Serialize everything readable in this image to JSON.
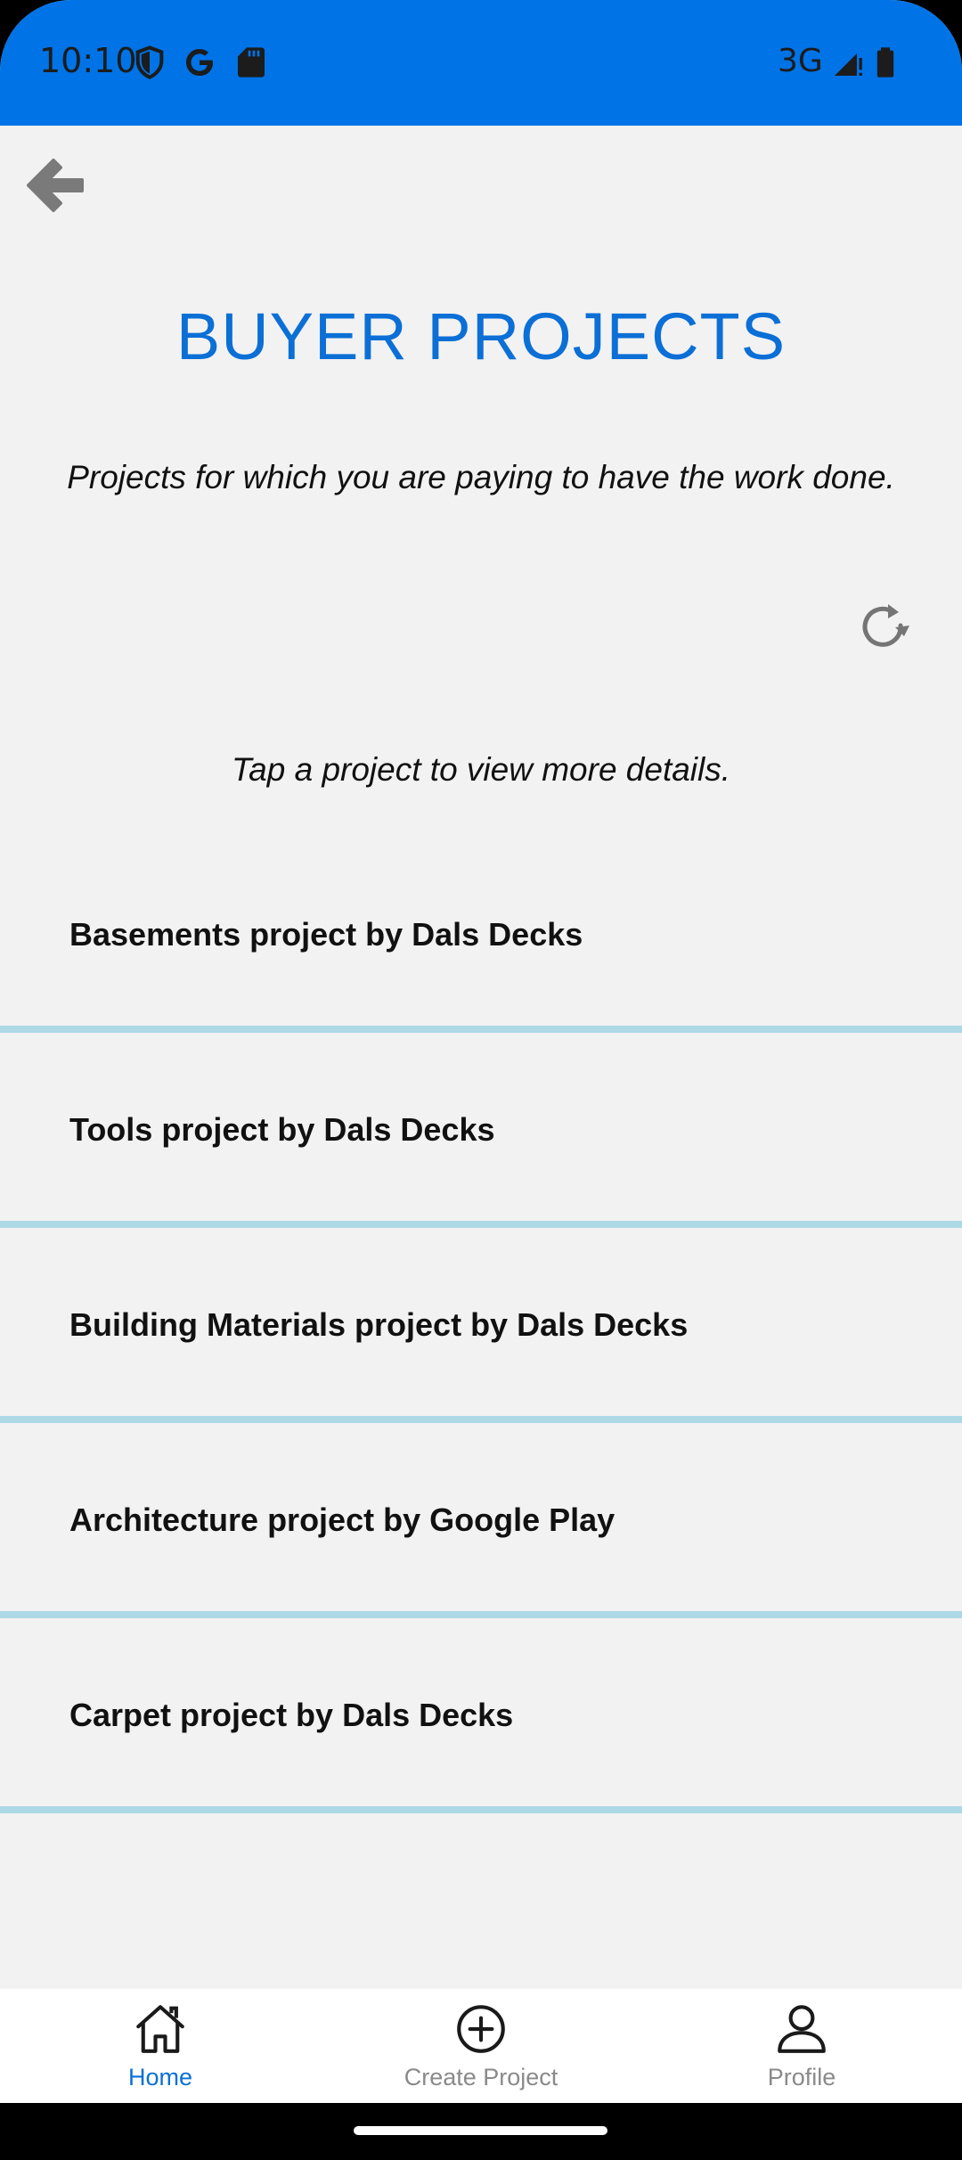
{
  "status_bar": {
    "time": "10:10",
    "network": "3G",
    "icons": [
      "shield-icon",
      "google-icon",
      "sd-card-icon",
      "signal-icon",
      "battery-icon"
    ]
  },
  "header": {
    "back_icon": "arrow-left-icon",
    "title": "BUYER PROJECTS",
    "subtitle": "Projects for which you are paying to have the work done.",
    "refresh_icon": "refresh-icon"
  },
  "hint": "Tap a project to view more details.",
  "projects": [
    {
      "label": "Basements project by Dals Decks"
    },
    {
      "label": "Tools project by Dals Decks"
    },
    {
      "label": "Building Materials project by Dals Decks"
    },
    {
      "label": "Architecture project by Google Play"
    },
    {
      "label": "Carpet project by Dals Decks"
    }
  ],
  "bottom_nav": {
    "items": [
      {
        "label": "Home",
        "icon": "home-icon",
        "active": true
      },
      {
        "label": "Create Project",
        "icon": "plus-circle-icon",
        "active": false
      },
      {
        "label": "Profile",
        "icon": "person-icon",
        "active": false
      }
    ]
  },
  "colors": {
    "accent": "#0b6fd6",
    "status_bar": "#0073e6",
    "divider": "#add8e6",
    "background": "#f2f2f2"
  }
}
